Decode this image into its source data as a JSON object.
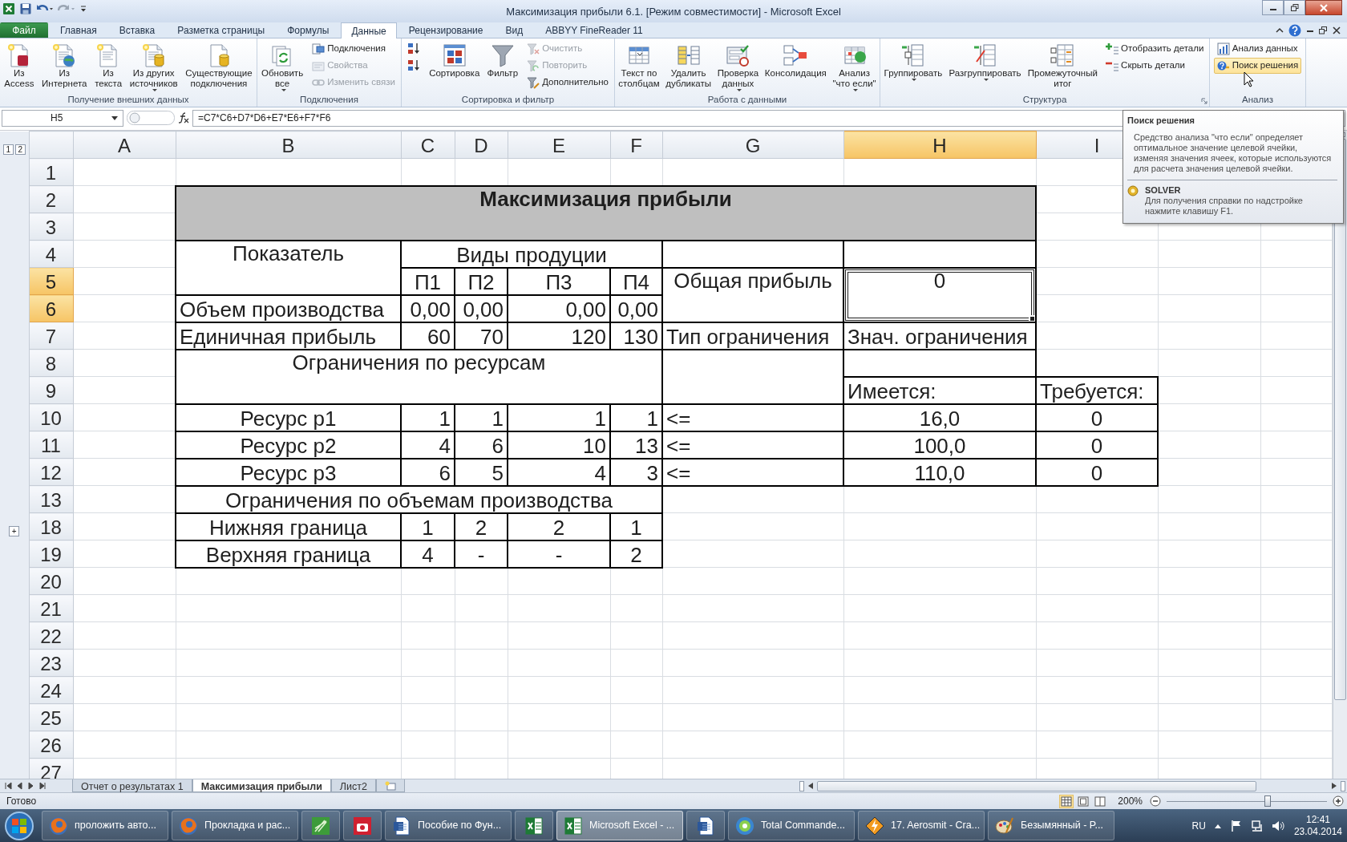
{
  "window": {
    "title": "Максимизация прибыли 6.1.  [Режим совместимости]  -  Microsoft Excel"
  },
  "tabs": [
    {
      "label": "Файл",
      "kind": "file",
      "selected": false
    },
    {
      "label": "Главная",
      "kind": "tab",
      "selected": false
    },
    {
      "label": "Вставка",
      "kind": "tab",
      "selected": false
    },
    {
      "label": "Разметка страницы",
      "kind": "tab",
      "selected": false
    },
    {
      "label": "Формулы",
      "kind": "tab",
      "selected": false
    },
    {
      "label": "Данные",
      "kind": "tab",
      "selected": true
    },
    {
      "label": "Рецензирование",
      "kind": "tab",
      "selected": false
    },
    {
      "label": "Вид",
      "kind": "tab",
      "selected": false
    },
    {
      "label": "ABBYY FineReader 11",
      "kind": "tab",
      "selected": false
    }
  ],
  "ribbon": [
    {
      "label": "Получение внешних данных",
      "launcher": false,
      "items": [
        {
          "kind": "large",
          "label": "Из\nAccess",
          "dropdown": false,
          "disabled": false,
          "highlighted": false
        },
        {
          "kind": "large",
          "label": "Из\nИнтернета",
          "dropdown": false,
          "disabled": false,
          "highlighted": false
        },
        {
          "kind": "large",
          "label": "Из\nтекста",
          "dropdown": false,
          "disabled": false,
          "highlighted": false
        },
        {
          "kind": "large",
          "label": "Из других\nисточников",
          "dropdown": true,
          "disabled": false,
          "highlighted": false
        },
        {
          "kind": "large",
          "label": "Существующие\nподключения",
          "dropdown": false,
          "disabled": false,
          "highlighted": false
        }
      ]
    },
    {
      "label": "Подключения",
      "launcher": false,
      "items": [
        {
          "kind": "large",
          "label": "Обновить\nвсе",
          "dropdown": true,
          "disabled": false,
          "highlighted": false
        },
        {
          "kind": "small",
          "label": "Подключения",
          "dropdown": false,
          "disabled": false,
          "highlighted": false
        },
        {
          "kind": "small",
          "label": "Свойства",
          "dropdown": false,
          "disabled": true,
          "highlighted": false
        },
        {
          "kind": "small",
          "label": "Изменить связи",
          "dropdown": false,
          "disabled": true,
          "highlighted": false
        }
      ]
    },
    {
      "label": "Сортировка и фильтр",
      "launcher": false,
      "items": [
        {
          "kind": "icon",
          "dropdown": false,
          "disabled": false,
          "highlighted": false
        },
        {
          "kind": "icon",
          "dropdown": false,
          "disabled": false,
          "highlighted": false
        },
        {
          "kind": "large",
          "label": "Сортировка",
          "dropdown": false,
          "disabled": false,
          "highlighted": false
        },
        {
          "kind": "large",
          "label": "Фильтр",
          "dropdown": false,
          "disabled": false,
          "highlighted": false
        },
        {
          "kind": "small",
          "label": "Очистить",
          "dropdown": false,
          "disabled": true,
          "highlighted": false
        },
        {
          "kind": "small",
          "label": "Повторить",
          "dropdown": false,
          "disabled": true,
          "highlighted": false
        },
        {
          "kind": "small",
          "label": "Дополнительно",
          "dropdown": false,
          "disabled": false,
          "highlighted": false
        }
      ]
    },
    {
      "label": "Работа с данными",
      "launcher": false,
      "items": [
        {
          "kind": "large",
          "label": "Текст по\nстолбцам",
          "dropdown": false,
          "disabled": false,
          "highlighted": false
        },
        {
          "kind": "large",
          "label": "Удалить\nдубликаты",
          "dropdown": false,
          "disabled": false,
          "highlighted": false
        },
        {
          "kind": "large",
          "label": "Проверка\nданных",
          "dropdown": true,
          "disabled": false,
          "highlighted": false
        },
        {
          "kind": "large",
          "label": "Консолидация",
          "dropdown": false,
          "disabled": false,
          "highlighted": false
        },
        {
          "kind": "large",
          "label": "Анализ\n\"что если\"",
          "dropdown": true,
          "disabled": false,
          "highlighted": false
        }
      ]
    },
    {
      "label": "Структура",
      "launcher": true,
      "items": [
        {
          "kind": "large",
          "label": "Группировать",
          "dropdown": true,
          "disabled": false,
          "highlighted": false
        },
        {
          "kind": "large",
          "label": "Разгруппировать",
          "dropdown": true,
          "disabled": false,
          "highlighted": false
        },
        {
          "kind": "large",
          "label": "Промежуточный\nитог",
          "dropdown": false,
          "disabled": false,
          "highlighted": false
        },
        {
          "kind": "small",
          "label": "Отобразить детали",
          "dropdown": false,
          "disabled": false,
          "highlighted": false
        },
        {
          "kind": "small",
          "label": "Скрыть детали",
          "dropdown": false,
          "disabled": false,
          "highlighted": false
        }
      ]
    },
    {
      "label": "Анализ",
      "launcher": false,
      "items": [
        {
          "kind": "small",
          "label": "Анализ данных",
          "dropdown": false,
          "disabled": false,
          "highlighted": false
        },
        {
          "kind": "small",
          "label": "Поиск решения",
          "dropdown": false,
          "disabled": false,
          "highlighted": true
        }
      ]
    }
  ],
  "formula_bar": {
    "name_box": "H5",
    "formula": "=C7*C6+D7*D6+E7*E6+F7*F6"
  },
  "sheet": {
    "outline_levels": [
      "1",
      "2"
    ],
    "columns": [
      {
        "label": "A",
        "selected": false
      },
      {
        "label": "B",
        "selected": false
      },
      {
        "label": "C",
        "selected": false
      },
      {
        "label": "D",
        "selected": false
      },
      {
        "label": "E",
        "selected": false
      },
      {
        "label": "F",
        "selected": false
      },
      {
        "label": "G",
        "selected": false
      },
      {
        "label": "H",
        "selected": true
      },
      {
        "label": "I",
        "selected": false
      }
    ],
    "rows": [
      {
        "label": "1",
        "selected": false,
        "cells": [
          {
            "kind": "blank",
            "selected": false
          }
        ]
      },
      {
        "label": "2",
        "selected": false,
        "cells": [
          {
            "kind": "blank",
            "selected": false
          },
          {
            "kind": "title",
            "text": "Максимизация прибыли",
            "colspan": 7,
            "rowspan": 2,
            "selected": false
          }
        ]
      },
      {
        "label": "3",
        "selected": false,
        "cells": [
          {
            "kind": "blank",
            "selected": false
          }
        ]
      },
      {
        "label": "4",
        "selected": false,
        "cells": [
          {
            "kind": "blank",
            "selected": false
          },
          {
            "kind": "centered",
            "text": "Показатель",
            "rowspan": 2,
            "selected": false
          },
          {
            "kind": "centered",
            "text": "Виды продуции",
            "colspan": 4,
            "selected": false
          },
          {
            "kind": "frame",
            "selected": false
          },
          {
            "kind": "frame",
            "selected": false
          }
        ]
      },
      {
        "label": "5",
        "selected": true,
        "cells": [
          {
            "kind": "blank",
            "selected": false
          },
          {
            "kind": "centered",
            "text": "П1",
            "selected": false
          },
          {
            "kind": "centered",
            "text": "П2",
            "selected": false
          },
          {
            "kind": "centered",
            "text": "П3",
            "selected": false
          },
          {
            "kind": "centered",
            "text": "П4",
            "selected": false
          },
          {
            "kind": "centered",
            "text": "Общая прибыль",
            "rowspan": 2,
            "selected": false
          },
          {
            "kind": "centered",
            "text": "0",
            "rowspan": 2,
            "selected": true
          }
        ]
      },
      {
        "label": "6",
        "selected": true,
        "cells": [
          {
            "kind": "blank",
            "selected": false
          },
          {
            "kind": "label",
            "text": "Объем производства",
            "selected": false
          },
          {
            "kind": "number",
            "text": "0,00",
            "selected": false
          },
          {
            "kind": "number",
            "text": "0,00",
            "selected": false
          },
          {
            "kind": "number",
            "text": "0,00",
            "selected": false
          },
          {
            "kind": "number",
            "text": "0,00",
            "selected": false
          }
        ]
      },
      {
        "label": "7",
        "selected": false,
        "cells": [
          {
            "kind": "blank",
            "selected": false
          },
          {
            "kind": "label",
            "text": "Единичная прибыль",
            "selected": false
          },
          {
            "kind": "number",
            "text": "60",
            "selected": false
          },
          {
            "kind": "number",
            "text": "70",
            "selected": false
          },
          {
            "kind": "number",
            "text": "120",
            "selected": false
          },
          {
            "kind": "number",
            "text": "130",
            "selected": false
          },
          {
            "kind": "label",
            "text": "Тип ограничения",
            "selected": false
          },
          {
            "kind": "label",
            "text": "Знач. ограничения",
            "selected": false
          }
        ]
      },
      {
        "label": "8",
        "selected": false,
        "cells": [
          {
            "kind": "blank",
            "selected": false
          },
          {
            "kind": "centered",
            "text": "Ограничения по ресурсам",
            "colspan": 5,
            "rowspan": 2,
            "selected": false
          },
          {
            "kind": "frame",
            "rowspan": 2,
            "selected": false
          },
          {
            "kind": "frame",
            "selected": false
          }
        ]
      },
      {
        "label": "9",
        "selected": false,
        "cells": [
          {
            "kind": "blank",
            "selected": false
          },
          {
            "kind": "label",
            "text": "Имеется:",
            "selected": false
          },
          {
            "kind": "label",
            "text": "Требуется:",
            "selected": false
          }
        ]
      },
      {
        "label": "10",
        "selected": false,
        "cells": [
          {
            "kind": "blank",
            "selected": false
          },
          {
            "kind": "centered",
            "text": "Ресурс p1",
            "selected": false
          },
          {
            "kind": "number",
            "text": "1",
            "selected": false
          },
          {
            "kind": "number",
            "text": "1",
            "selected": false
          },
          {
            "kind": "number",
            "text": "1",
            "selected": false
          },
          {
            "kind": "number",
            "text": "1",
            "selected": false
          },
          {
            "kind": "label",
            "text": "<=",
            "selected": false
          },
          {
            "kind": "centered",
            "text": "16,0",
            "selected": false
          },
          {
            "kind": "centered",
            "text": "0",
            "selected": false
          }
        ]
      },
      {
        "label": "11",
        "selected": false,
        "cells": [
          {
            "kind": "blank",
            "selected": false
          },
          {
            "kind": "centered",
            "text": "Ресурс p2",
            "selected": false
          },
          {
            "kind": "number",
            "text": "4",
            "selected": false
          },
          {
            "kind": "number",
            "text": "6",
            "selected": false
          },
          {
            "kind": "number",
            "text": "10",
            "selected": false
          },
          {
            "kind": "number",
            "text": "13",
            "selected": false
          },
          {
            "kind": "label",
            "text": "<=",
            "selected": false
          },
          {
            "kind": "centered",
            "text": "100,0",
            "selected": false
          },
          {
            "kind": "centered",
            "text": "0",
            "selected": false
          }
        ]
      },
      {
        "label": "12",
        "selected": false,
        "cells": [
          {
            "kind": "blank",
            "selected": false
          },
          {
            "kind": "centered",
            "text": "Ресурс p3",
            "selected": false
          },
          {
            "kind": "number",
            "text": "6",
            "selected": false
          },
          {
            "kind": "number",
            "text": "5",
            "selected": false
          },
          {
            "kind": "number",
            "text": "4",
            "selected": false
          },
          {
            "kind": "number",
            "text": "3",
            "selected": false
          },
          {
            "kind": "label",
            "text": "<=",
            "selected": false
          },
          {
            "kind": "centered",
            "text": "110,0",
            "selected": false
          },
          {
            "kind": "centered",
            "text": "0",
            "selected": false
          }
        ]
      },
      {
        "label": "13",
        "selected": false,
        "cells": [
          {
            "kind": "blank",
            "selected": false
          },
          {
            "kind": "centered",
            "text": "Ограничения по объемам производства",
            "colspan": 5,
            "selected": false
          }
        ]
      },
      {
        "label": "18",
        "selected": false,
        "outline": "+",
        "cells": [
          {
            "kind": "blank",
            "selected": false
          },
          {
            "kind": "centered",
            "text": "Нижняя граница",
            "selected": false
          },
          {
            "kind": "centered",
            "text": "1",
            "selected": false
          },
          {
            "kind": "centered",
            "text": "2",
            "selected": false
          },
          {
            "kind": "centered",
            "text": "2",
            "selected": false
          },
          {
            "kind": "centered",
            "text": "1",
            "selected": false
          }
        ]
      },
      {
        "label": "19",
        "selected": false,
        "cells": [
          {
            "kind": "blank",
            "selected": false
          },
          {
            "kind": "centered",
            "text": "Верхняя граница",
            "selected": false
          },
          {
            "kind": "centered",
            "text": "4",
            "selected": false
          },
          {
            "kind": "centered",
            "text": "-",
            "selected": false
          },
          {
            "kind": "centered",
            "text": "-",
            "selected": false
          },
          {
            "kind": "centered",
            "text": "2",
            "selected": false
          }
        ]
      },
      {
        "label": "20",
        "selected": false,
        "cells": [
          {
            "kind": "blank",
            "selected": false
          }
        ]
      },
      {
        "label": "21",
        "selected": false,
        "cells": [
          {
            "kind": "blank",
            "selected": false
          }
        ]
      },
      {
        "label": "22",
        "selected": false,
        "cells": [
          {
            "kind": "blank",
            "selected": false
          }
        ]
      },
      {
        "label": "23",
        "selected": false,
        "cells": [
          {
            "kind": "blank",
            "selected": false
          }
        ]
      },
      {
        "label": "24",
        "selected": false,
        "cells": [
          {
            "kind": "blank",
            "selected": false
          }
        ]
      },
      {
        "label": "25",
        "selected": false,
        "cells": [
          {
            "kind": "blank",
            "selected": false
          }
        ]
      },
      {
        "label": "26",
        "selected": false,
        "cells": [
          {
            "kind": "blank",
            "selected": false
          }
        ]
      },
      {
        "label": "27",
        "selected": false,
        "cells": [
          {
            "kind": "blank",
            "selected": false
          }
        ]
      }
    ]
  },
  "tooltip": {
    "title": "Поиск решения",
    "description": "Средство анализа \"что если\" определяет оптимальное значение целевой ячейки, изменяя значения ячеек, которые используются для расчета значения целевой ячейки.",
    "addin": "SOLVER",
    "help": "Для получения справки по надстройке нажмите клавишу F1."
  },
  "sheet_tabs": [
    {
      "label": "Отчет о результатах 1",
      "selected": false
    },
    {
      "label": "Максимизация прибыли",
      "selected": true
    },
    {
      "label": "Лист2",
      "selected": false
    }
  ],
  "status_bar": {
    "text": "Готово",
    "views": [
      {
        "selected": true
      },
      {
        "selected": false
      },
      {
        "selected": false
      }
    ],
    "zoom": "200%",
    "zoom_slider": {
      "level": 0.63
    }
  },
  "taskbar": {
    "items": [
      {
        "kind": "browser",
        "label": "проложить авто...",
        "selected": false
      },
      {
        "kind": "browser",
        "label": "Прокладка и рас...",
        "selected": false
      },
      {
        "kind": "draw",
        "selected": false
      },
      {
        "kind": "camera",
        "selected": false
      },
      {
        "kind": "word",
        "label": "Пособие по Фун...",
        "selected": false
      },
      {
        "kind": "sheet",
        "selected": false
      },
      {
        "kind": "sheet",
        "label": "Microsoft Excel - ...",
        "selected": true
      },
      {
        "kind": "word",
        "selected": false
      },
      {
        "kind": "files",
        "label": "Total Commande...",
        "selected": false
      },
      {
        "kind": "player",
        "label": "17. Aerosmit - Cra...",
        "selected": false
      },
      {
        "kind": "paint",
        "label": "Безымянный - P...",
        "selected": false
      }
    ],
    "language": "RU",
    "time": "12:41",
    "date": "23.04.2014"
  }
}
